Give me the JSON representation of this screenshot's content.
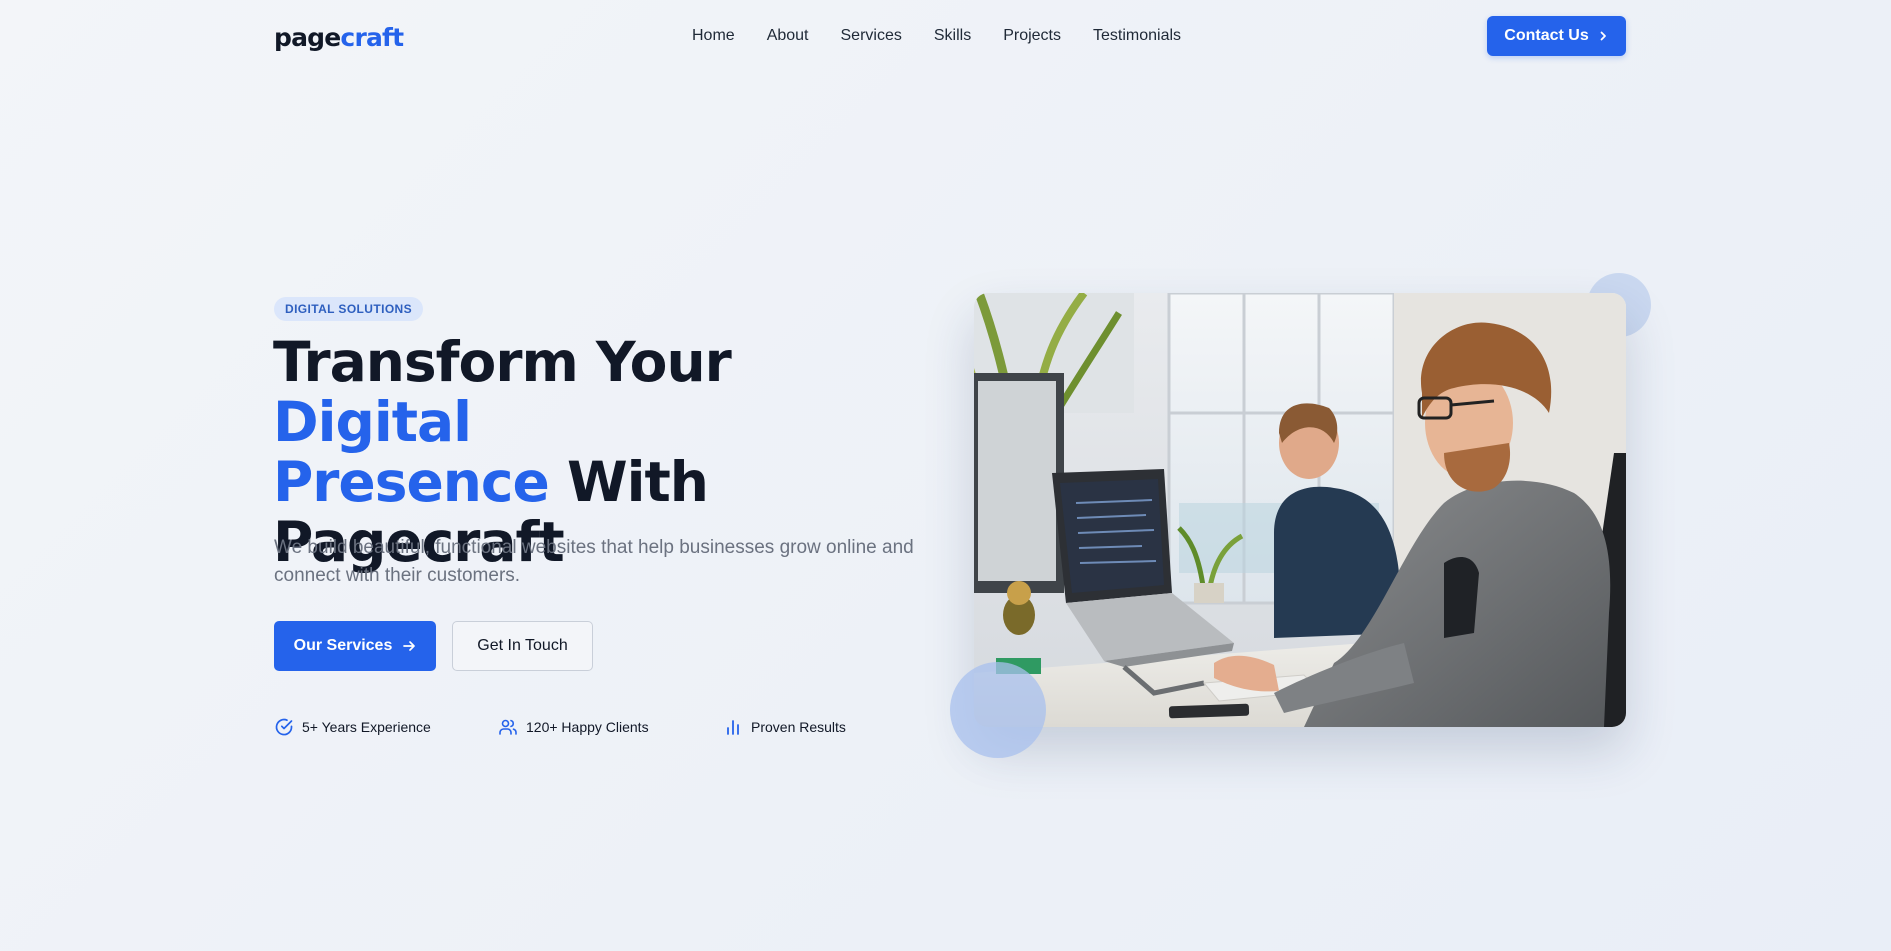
{
  "header": {
    "logo_part1": "page",
    "logo_part2": "craft",
    "nav": [
      "Home",
      "About",
      "Services",
      "Skills",
      "Projects",
      "Testimonials"
    ],
    "contact_label": "Contact Us"
  },
  "hero": {
    "badge": "DIGITAL SOLUTIONS",
    "title_part1": "Transform Your ",
    "title_accent1": "Digital",
    "title_accent2": "Presence",
    "title_part2": " With",
    "title_part3": "Pagecraft",
    "subtitle": "We build beautiful, functional websites that help businesses grow online and connect with their customers.",
    "primary_btn": "Our Services",
    "secondary_btn": "Get In Touch",
    "stats": [
      {
        "icon": "check-circle-icon",
        "label": "5+ Years Experience"
      },
      {
        "icon": "users-icon",
        "label": "120+ Happy Clients"
      },
      {
        "icon": "bar-chart-icon",
        "label": "Proven Results"
      }
    ],
    "image_icon": "office-photo"
  },
  "colors": {
    "accent": "#2563eb",
    "text": "#111827",
    "muted": "#6b7280",
    "background": "#f0f3f8"
  }
}
